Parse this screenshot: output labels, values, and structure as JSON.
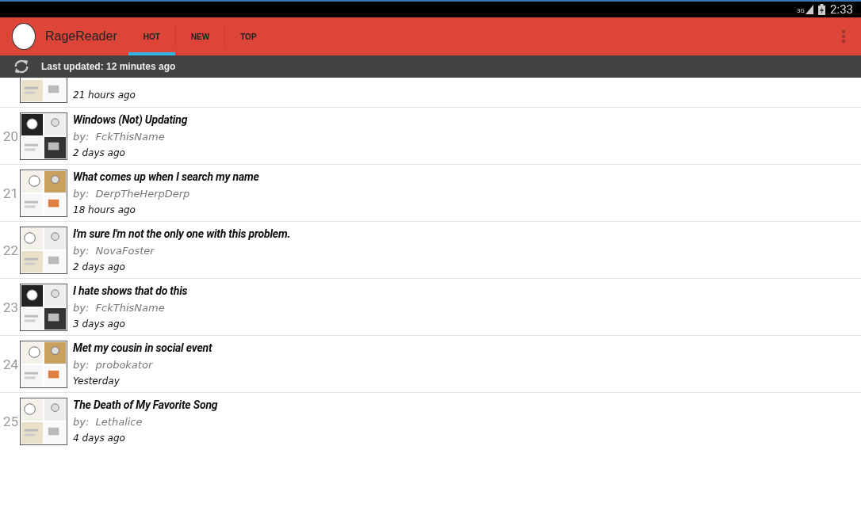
{
  "status_bar": {
    "network": "3G",
    "time": "2:33"
  },
  "app_bar": {
    "title": "RageReader",
    "tabs": [
      {
        "label": "HOT",
        "selected": true
      },
      {
        "label": "NEW",
        "selected": false
      },
      {
        "label": "TOP",
        "selected": false
      }
    ]
  },
  "update_bar": {
    "text": "Last updated: 12 minutes ago"
  },
  "posts": [
    {
      "time": "21 hours ago"
    },
    {
      "number": "20",
      "title": "Windows (Not) Updating",
      "author": "by:  FckThisName",
      "time": "2 days ago"
    },
    {
      "number": "21",
      "title": "What comes up when I search my name",
      "author": "by:  DerpTheHerpDerp",
      "time": "18 hours ago"
    },
    {
      "number": "22",
      "title": "I'm sure I'm not the only one with this problem.",
      "author": "by:  NovaFoster",
      "time": "2 days ago"
    },
    {
      "number": "23",
      "title": "I hate shows that do this",
      "author": "by:  FckThisName",
      "time": "3 days ago"
    },
    {
      "number": "24",
      "title": "Met my cousin in social event",
      "author": "by:  probokator",
      "time": "Yesterday"
    },
    {
      "number": "25",
      "title": "The Death of My Favorite Song",
      "author": "by:  Lethalice",
      "time": "4 days ago"
    }
  ]
}
